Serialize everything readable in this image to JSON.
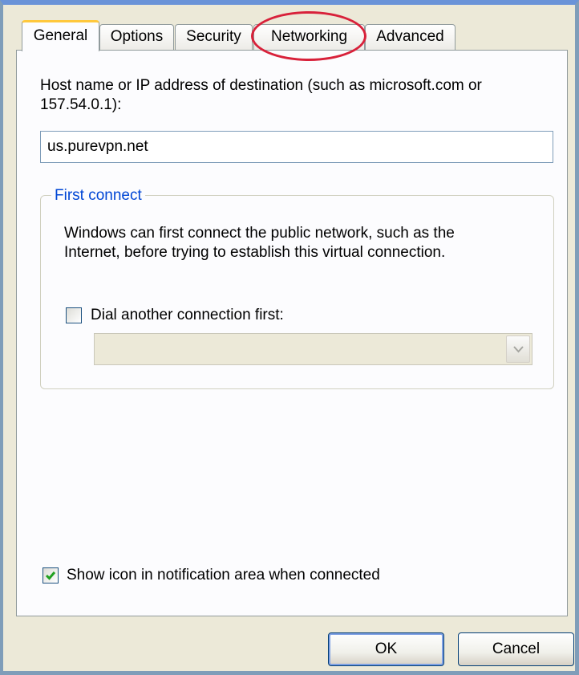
{
  "tabs": [
    {
      "label": "General",
      "active": true
    },
    {
      "label": "Options",
      "active": false
    },
    {
      "label": "Security",
      "active": false
    },
    {
      "label": "Networking",
      "active": false,
      "highlighted": true
    },
    {
      "label": "Advanced",
      "active": false
    }
  ],
  "general": {
    "host_label_line1": "Host name or IP address of destination (such as microsoft.com or",
    "host_label_line2": "157.54.0.1):",
    "host_value": "us.purevpn.net",
    "first_connect": {
      "title": "First connect",
      "description_line1": "Windows can first connect the public network, such as the",
      "description_line2": "Internet, before trying to establish this virtual connection.",
      "dial_first_label": "Dial another connection first:",
      "dial_first_checked": false,
      "connection_select_value": "",
      "connection_select_disabled": true
    },
    "show_icon_label": "Show icon in notification area when connected",
    "show_icon_checked": true
  },
  "buttons": {
    "ok_label": "OK",
    "cancel_label": "Cancel"
  },
  "colors": {
    "group_title": "#0046d5",
    "tab_active_accent": "#ffc83c",
    "highlight_circle": "#d8213a",
    "checkmark": "#21a121"
  }
}
